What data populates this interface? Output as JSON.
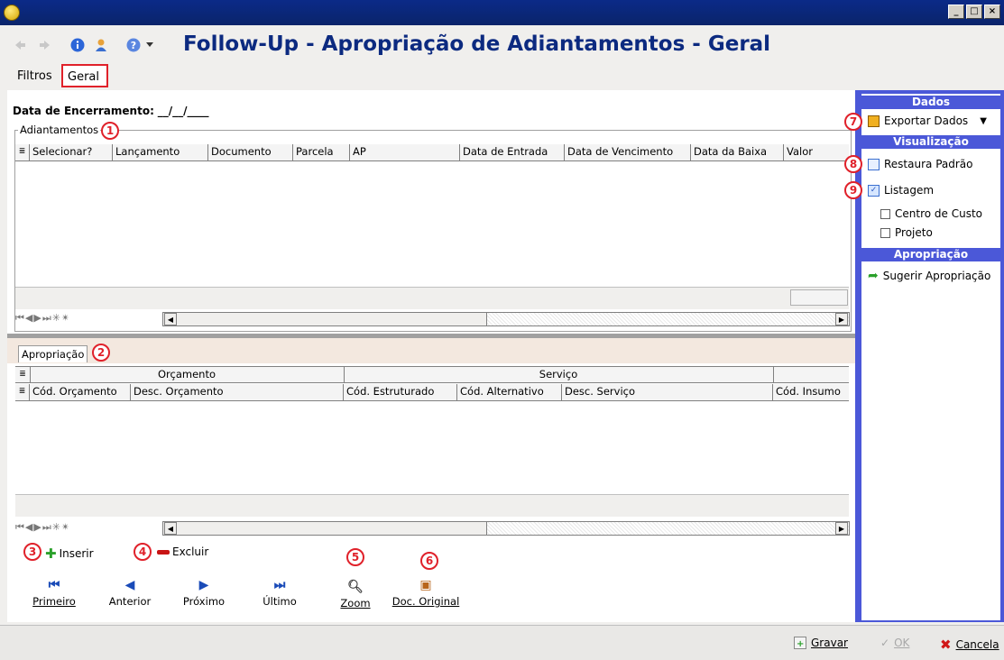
{
  "window": {
    "minimize": "_",
    "maximize": "□",
    "close": "×"
  },
  "header": {
    "title": "Follow-Up - Apropriação de Adiantamentos - Geral"
  },
  "tabs": [
    {
      "label": "Filtros"
    },
    {
      "label": "Geral"
    }
  ],
  "form": {
    "data_encerramento_label": "Data de Encerramento:",
    "data_encerramento_value": "__/__/____"
  },
  "adiantamentos": {
    "title": "Adiantamentos",
    "columns": [
      "Selecionar?",
      "Lançamento",
      "Documento",
      "Parcela",
      "AP",
      "Data de Entrada",
      "Data de Vencimento",
      "Data da Baixa",
      "Valor"
    ]
  },
  "apropriacao": {
    "tab_label": "Apropriação",
    "group_headers": [
      "Orçamento",
      "Serviço"
    ],
    "columns": [
      "Cód. Orçamento",
      "Desc. Orçamento",
      "Cód. Estruturado",
      "Cód. Alternativo",
      "Desc. Serviço",
      "Cód. Insumo"
    ]
  },
  "actions": {
    "inserir": "Inserir",
    "excluir": "Excluir"
  },
  "nav": {
    "primeiro": "Primeiro",
    "anterior": "Anterior",
    "proximo": "Próximo",
    "ultimo": "Último",
    "zoom": "Zoom",
    "doc_original": "Doc. Original"
  },
  "callouts": [
    "1",
    "2",
    "3",
    "4",
    "5",
    "6",
    "7",
    "8",
    "9"
  ],
  "side": {
    "dados_header": "Dados",
    "exportar": "Exportar Dados",
    "visualizacao_header": "Visualização",
    "restaura": "Restaura Padrão",
    "listagem": "Listagem",
    "centro_custo": "Centro de Custo",
    "projeto": "Projeto",
    "apropriacao_header": "Apropriação",
    "sugerir": "Sugerir Apropriação"
  },
  "footer": {
    "gravar": "Gravar",
    "ok": "OK",
    "cancela": "Cancela"
  },
  "colors": {
    "title_blue": "#0c2a80",
    "side_blue": "#4b58d8",
    "callout_red": "#e0212a"
  }
}
